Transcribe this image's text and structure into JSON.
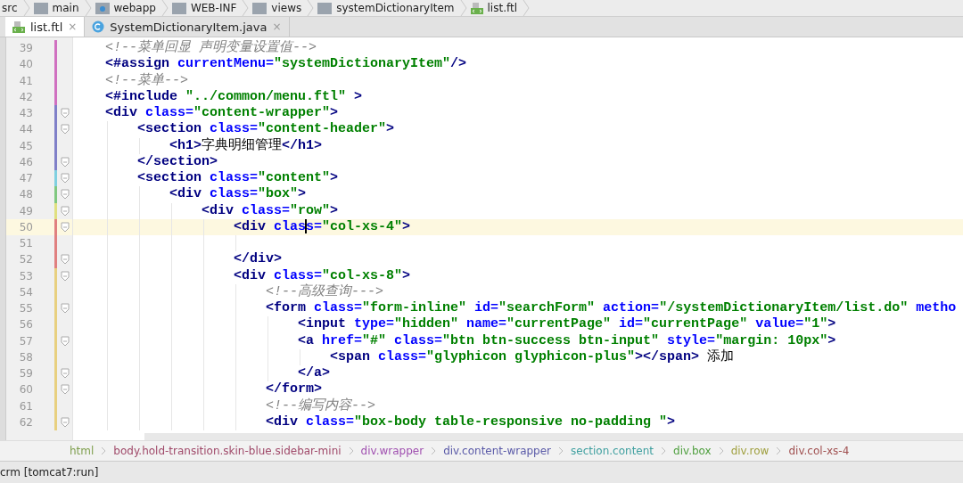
{
  "nav_bar": {
    "items": [
      {
        "label": "src",
        "kind": "plain"
      },
      {
        "label": "main",
        "kind": "folder"
      },
      {
        "label": "webapp",
        "kind": "webfolder"
      },
      {
        "label": "WEB-INF",
        "kind": "folder"
      },
      {
        "label": "views",
        "kind": "folder"
      },
      {
        "label": "systemDictionaryItem",
        "kind": "folder"
      },
      {
        "label": "list.ftl",
        "kind": "ftl"
      }
    ]
  },
  "tabs": [
    {
      "label": "list.ftl",
      "kind": "ftl",
      "selected": true,
      "close": "×"
    },
    {
      "label": "SystemDictionaryItem.java",
      "kind": "java",
      "selected": false,
      "close": "×"
    }
  ],
  "editor": {
    "lines": [
      {
        "number": "39",
        "color": "#d070c0",
        "fold": false,
        "current": false,
        "tokens": [
          {
            "kind": "comment",
            "text": "<!--菜单回显 声明变量设置值-->"
          }
        ]
      },
      {
        "number": "40",
        "color": "#d070c0",
        "fold": false,
        "current": false,
        "tokens": [
          {
            "kind": "tag",
            "text": "<#assign"
          },
          {
            "kind": "attr",
            "text": " currentMenu="
          },
          {
            "kind": "value",
            "text": "\"systemDictionaryItem\""
          },
          {
            "kind": "tag",
            "text": "/>"
          }
        ]
      },
      {
        "number": "41",
        "color": "#d070c0",
        "fold": false,
        "current": false,
        "tokens": [
          {
            "kind": "comment",
            "text": "<!--菜单-->"
          }
        ]
      },
      {
        "number": "42",
        "color": "#d070c0",
        "fold": false,
        "current": false,
        "tokens": [
          {
            "kind": "tag",
            "text": "<#include"
          },
          {
            "kind": "value",
            "text": " \"../common/menu.ftl\""
          },
          {
            "kind": "tag",
            "text": " >"
          }
        ]
      },
      {
        "number": "43",
        "color": "#8080c8",
        "fold": true,
        "current": false,
        "tokens": [
          {
            "kind": "tag",
            "text": "<div"
          },
          {
            "kind": "attr",
            "text": " class="
          },
          {
            "kind": "value",
            "text": "\"content-wrapper\""
          },
          {
            "kind": "tag",
            "text": ">"
          }
        ],
        "children": [
          {
            "number": "44",
            "color": "#8080c8",
            "fold": true,
            "current": false,
            "tokens": [
              {
                "kind": "tag",
                "text": "<section"
              },
              {
                "kind": "attr",
                "text": " class="
              },
              {
                "kind": "value",
                "text": "\"content-header\""
              },
              {
                "kind": "tag",
                "text": ">"
              }
            ],
            "children": [
              {
                "number": "45",
                "color": "#8080c8",
                "fold": false,
                "current": false,
                "tokens": [
                  {
                    "kind": "tag",
                    "text": "<h1>"
                  },
                  {
                    "kind": "text",
                    "text": "字典明细管理"
                  },
                  {
                    "kind": "tag",
                    "text": "</h1>"
                  }
                ]
              }
            ]
          },
          {
            "number": "46",
            "color": "#8080c8",
            "fold": true,
            "current": false,
            "tokens": [
              {
                "kind": "tag",
                "text": "</section>"
              }
            ]
          },
          {
            "number": "47",
            "color": "#80d0e0",
            "fold": true,
            "current": false,
            "tokens": [
              {
                "kind": "tag",
                "text": "<section"
              },
              {
                "kind": "attr",
                "text": " class="
              },
              {
                "kind": "value",
                "text": "\"content\""
              },
              {
                "kind": "tag",
                "text": ">"
              }
            ],
            "children": [
              {
                "number": "48",
                "color": "#80c880",
                "fold": true,
                "current": false,
                "tokens": [
                  {
                    "kind": "tag",
                    "text": "<div"
                  },
                  {
                    "kind": "attr",
                    "text": " class="
                  },
                  {
                    "kind": "value",
                    "text": "\"box\""
                  },
                  {
                    "kind": "tag",
                    "text": ">"
                  }
                ],
                "children": [
                  {
                    "number": "49",
                    "color": "#e0e080",
                    "fold": true,
                    "current": false,
                    "tokens": [
                      {
                        "kind": "tag",
                        "text": "<div"
                      },
                      {
                        "kind": "attr",
                        "text": " class="
                      },
                      {
                        "kind": "value",
                        "text": "\"row\""
                      },
                      {
                        "kind": "tag",
                        "text": ">"
                      }
                    ],
                    "children": [
                      {
                        "number": "50",
                        "color": "#e08080",
                        "fold": true,
                        "current": true,
                        "tokens": [
                          {
                            "kind": "tag",
                            "text": "<div"
                          },
                          {
                            "kind": "attr",
                            "text": " clas"
                          },
                          {
                            "kind": "caret"
                          },
                          {
                            "kind": "attr",
                            "text": "s="
                          },
                          {
                            "kind": "value",
                            "text": "\"col-xs-4\""
                          },
                          {
                            "kind": "tag",
                            "text": ">"
                          }
                        ],
                        "children": [
                          {
                            "number": "51",
                            "color": "#e08080",
                            "fold": false,
                            "current": false
                          }
                        ]
                      },
                      {
                        "number": "52",
                        "color": "#e08080",
                        "fold": true,
                        "current": false,
                        "tokens": [
                          {
                            "kind": "tag",
                            "text": "</div>"
                          }
                        ]
                      },
                      {
                        "number": "53",
                        "color": "#e8d080",
                        "fold": true,
                        "current": false,
                        "tokens": [
                          {
                            "kind": "tag",
                            "text": "<div"
                          },
                          {
                            "kind": "attr",
                            "text": " class="
                          },
                          {
                            "kind": "value",
                            "text": "\"col-xs-8\""
                          },
                          {
                            "kind": "tag",
                            "text": ">"
                          }
                        ],
                        "children": [
                          {
                            "number": "54",
                            "color": "#e8d080",
                            "fold": false,
                            "current": false,
                            "tokens": [
                              {
                                "kind": "comment",
                                "text": "<!--高级查询--->"
                              }
                            ]
                          },
                          {
                            "number": "55",
                            "color": "#e8d080",
                            "fold": true,
                            "current": false,
                            "tokens": [
                              {
                                "kind": "tag",
                                "text": "<form"
                              },
                              {
                                "kind": "attr",
                                "text": " class="
                              },
                              {
                                "kind": "value",
                                "text": "\"form-inline\""
                              },
                              {
                                "kind": "attr",
                                "text": " id="
                              },
                              {
                                "kind": "value",
                                "text": "\"searchForm\""
                              },
                              {
                                "kind": "attr",
                                "text": " action="
                              },
                              {
                                "kind": "value",
                                "text": "\"/systemDictionaryItem/list.do\""
                              },
                              {
                                "kind": "attr",
                                "text": " metho"
                              }
                            ],
                            "children": [
                              {
                                "number": "56",
                                "color": "#e8d080",
                                "fold": false,
                                "current": false,
                                "tokens": [
                                  {
                                    "kind": "tag",
                                    "text": "<input"
                                  },
                                  {
                                    "kind": "attr",
                                    "text": " type="
                                  },
                                  {
                                    "kind": "value",
                                    "text": "\"hidden\""
                                  },
                                  {
                                    "kind": "attr",
                                    "text": " name="
                                  },
                                  {
                                    "kind": "value",
                                    "text": "\"currentPage\""
                                  },
                                  {
                                    "kind": "attr",
                                    "text": " id="
                                  },
                                  {
                                    "kind": "value",
                                    "text": "\"currentPage\""
                                  },
                                  {
                                    "kind": "attr",
                                    "text": " value="
                                  },
                                  {
                                    "kind": "value",
                                    "text": "\"1\""
                                  },
                                  {
                                    "kind": "tag",
                                    "text": ">"
                                  }
                                ]
                              },
                              {
                                "number": "57",
                                "color": "#e8d080",
                                "fold": true,
                                "current": false,
                                "tokens": [
                                  {
                                    "kind": "tag",
                                    "text": "<a"
                                  },
                                  {
                                    "kind": "attr",
                                    "text": " href="
                                  },
                                  {
                                    "kind": "value",
                                    "text": "\"#\""
                                  },
                                  {
                                    "kind": "attr",
                                    "text": " class="
                                  },
                                  {
                                    "kind": "value",
                                    "text": "\"btn btn-success btn-input\""
                                  },
                                  {
                                    "kind": "attr",
                                    "text": " style="
                                  },
                                  {
                                    "kind": "value",
                                    "text": "\"margin: 10px\""
                                  },
                                  {
                                    "kind": "tag",
                                    "text": ">"
                                  }
                                ],
                                "children": [
                                  {
                                    "number": "58",
                                    "color": "#e8d080",
                                    "fold": false,
                                    "current": false,
                                    "tokens": [
                                      {
                                        "kind": "tag",
                                        "text": "<span"
                                      },
                                      {
                                        "kind": "attr",
                                        "text": " class="
                                      },
                                      {
                                        "kind": "value",
                                        "text": "\"glyphicon glyphicon-plus\""
                                      },
                                      {
                                        "kind": "tag",
                                        "text": "></span>"
                                      },
                                      {
                                        "kind": "text",
                                        "text": " 添加"
                                      }
                                    ]
                                  }
                                ]
                              },
                              {
                                "number": "59",
                                "color": "#e8d080",
                                "fold": true,
                                "current": false,
                                "tokens": [
                                  {
                                    "kind": "tag",
                                    "text": "</a>"
                                  }
                                ]
                              }
                            ]
                          },
                          {
                            "number": "60",
                            "color": "#e8d080",
                            "fold": true,
                            "current": false,
                            "tokens": [
                              {
                                "kind": "tag",
                                "text": "</form>"
                              }
                            ]
                          },
                          {
                            "number": "61",
                            "color": "#e8d080",
                            "fold": false,
                            "current": false,
                            "tokens": [
                              {
                                "kind": "comment",
                                "text": "<!--编写内容-->"
                              }
                            ]
                          },
                          {
                            "number": "62",
                            "color": "#e8d080",
                            "fold": true,
                            "current": false,
                            "tokens": [
                              {
                                "kind": "tag",
                                "text": "<div"
                              },
                              {
                                "kind": "attr",
                                "text": " class="
                              },
                              {
                                "kind": "value",
                                "text": "\"box-body table-responsive no-padding \""
                              },
                              {
                                "kind": "tag",
                                "text": ">"
                              }
                            ]
                          }
                        ]
                      }
                    ]
                  }
                ]
              }
            ]
          }
        ]
      }
    ]
  },
  "breadcrumbs": [
    {
      "label": "html",
      "color": "#80a050"
    },
    {
      "label": "body.hold-transition.skin-blue.sidebar-mini",
      "color": "#a04a6a"
    },
    {
      "label": "div.wrapper",
      "color": "#a050b0"
    },
    {
      "label": "div.content-wrapper",
      "color": "#5a5aa8"
    },
    {
      "label": "section.content",
      "color": "#40a0a0"
    },
    {
      "label": "div.box",
      "color": "#50a040"
    },
    {
      "label": "div.row",
      "color": "#a0a040"
    },
    {
      "label": "div.col-xs-4",
      "color": "#a05050"
    }
  ],
  "status_bar": {
    "text": "crm [tomcat7:run]"
  }
}
